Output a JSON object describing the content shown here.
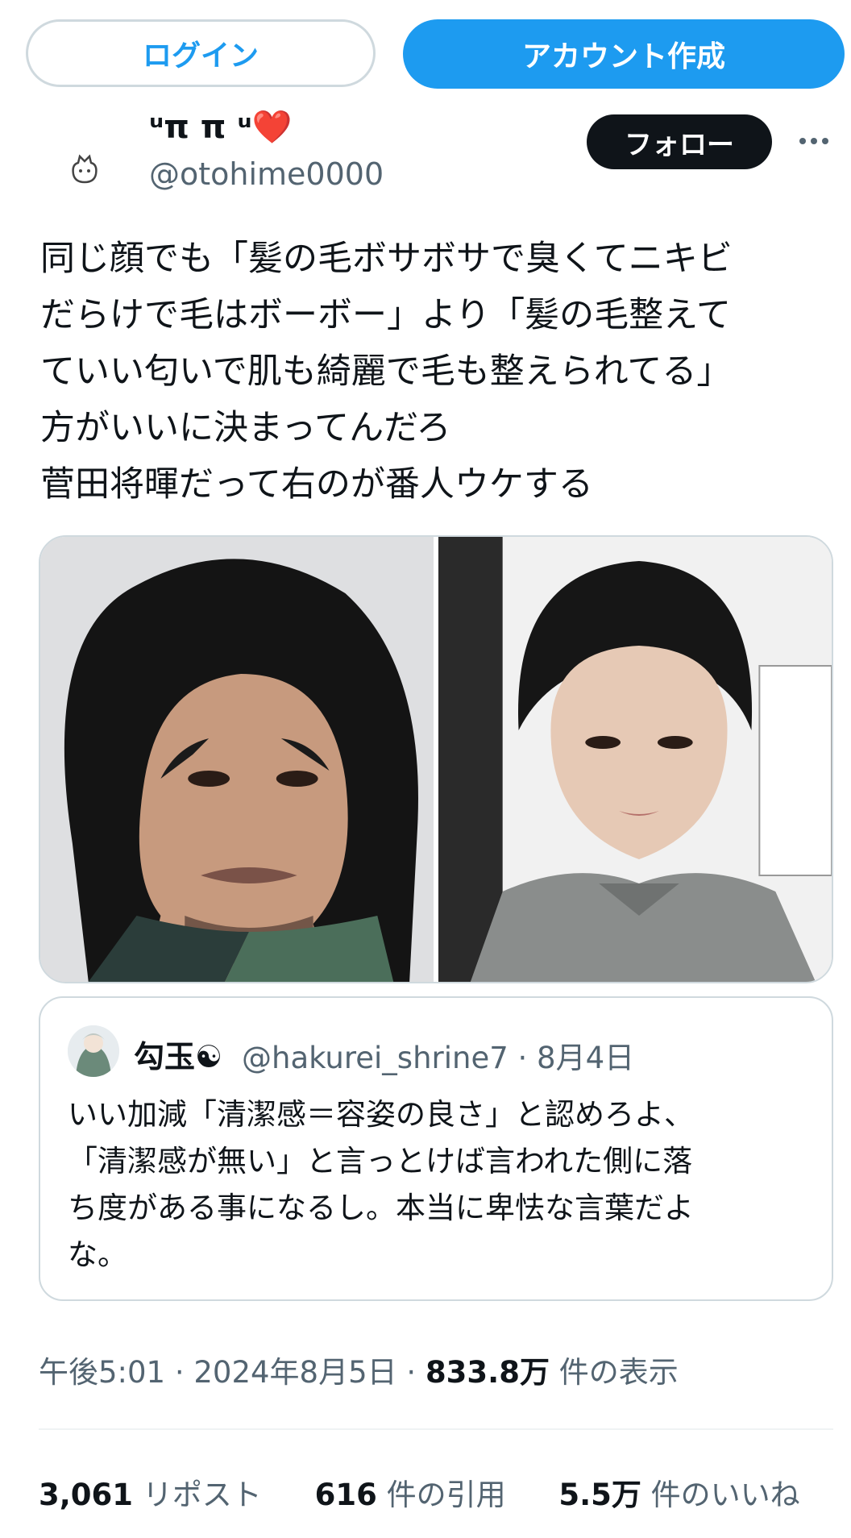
{
  "top_bar": {
    "login_label": "ログイン",
    "signup_label": "アカウント作成"
  },
  "author": {
    "display_name": "ᵘπ π ᵘ❤️",
    "handle": "@otohime0000",
    "avatar_icon": "cat-icon",
    "follow_label": "フォロー",
    "more_icon": "more-icon"
  },
  "tweet": {
    "text": "同じ顔でも「髪の毛ボサボサで臭くてニキビ\nだらけで毛はボーボー」より「髪の毛整えて\nていい匂いで肌も綺麗で毛も整えられてる」\n方がいいに決まってんだろ\n菅田将暉だって右のが番人ウケする"
  },
  "quote": {
    "display_name": "勾玉☯",
    "handle_date": "@hakurei_shrine7 · 8月4日",
    "text": "いい加減「清潔感＝容姿の良さ」と認めろよ、\n「清潔感が無い」と言っとけば言われた側に落\nち度がある事になるし。本当に卑怯な言葉だよ\nな。"
  },
  "meta": {
    "time": "午後5:01",
    "date": "2024年8月5日",
    "views_count": "833.8万",
    "views_label": "件の表示"
  },
  "stats": {
    "reposts_count": "3,061",
    "reposts_label": "リポスト",
    "quotes_count": "616",
    "quotes_label": "件の引用",
    "likes_count": "5.5万",
    "likes_label": "件のいいね"
  },
  "colors": {
    "accent": "#1d9bf0",
    "text": "#0f1419",
    "muted": "#536471",
    "border": "#cfd9de"
  }
}
